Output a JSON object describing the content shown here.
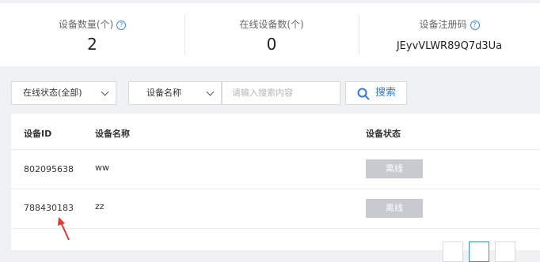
{
  "stats": {
    "device_count": {
      "label": "设备数量(个)",
      "value": "2"
    },
    "online_count": {
      "label": "在线设备数(个)",
      "value": "0"
    },
    "register_code": {
      "label": "设备注册码",
      "value": "JEyvVLWR89Q7d3Ua"
    },
    "help_glyph": "?"
  },
  "filters": {
    "status_select": "在线状态(全部)",
    "field_select": "设备名称",
    "search_placeholder": "请输入搜索内容",
    "search_button": "搜索"
  },
  "table": {
    "headers": {
      "id": "设备ID",
      "name": "设备名称",
      "status": "设备状态"
    },
    "rows": [
      {
        "id": "802095638",
        "name": "ww",
        "status": "离线"
      },
      {
        "id": "788430183",
        "name": "zz",
        "status": "离线"
      }
    ]
  },
  "colors": {
    "accent": "#3d8af7",
    "offline_badge": "#c7cbd0",
    "annotation_arrow": "#e8392f"
  },
  "icons": [
    "help-icon",
    "chevron-down-icon",
    "search-icon",
    "arrow-annotation"
  ]
}
